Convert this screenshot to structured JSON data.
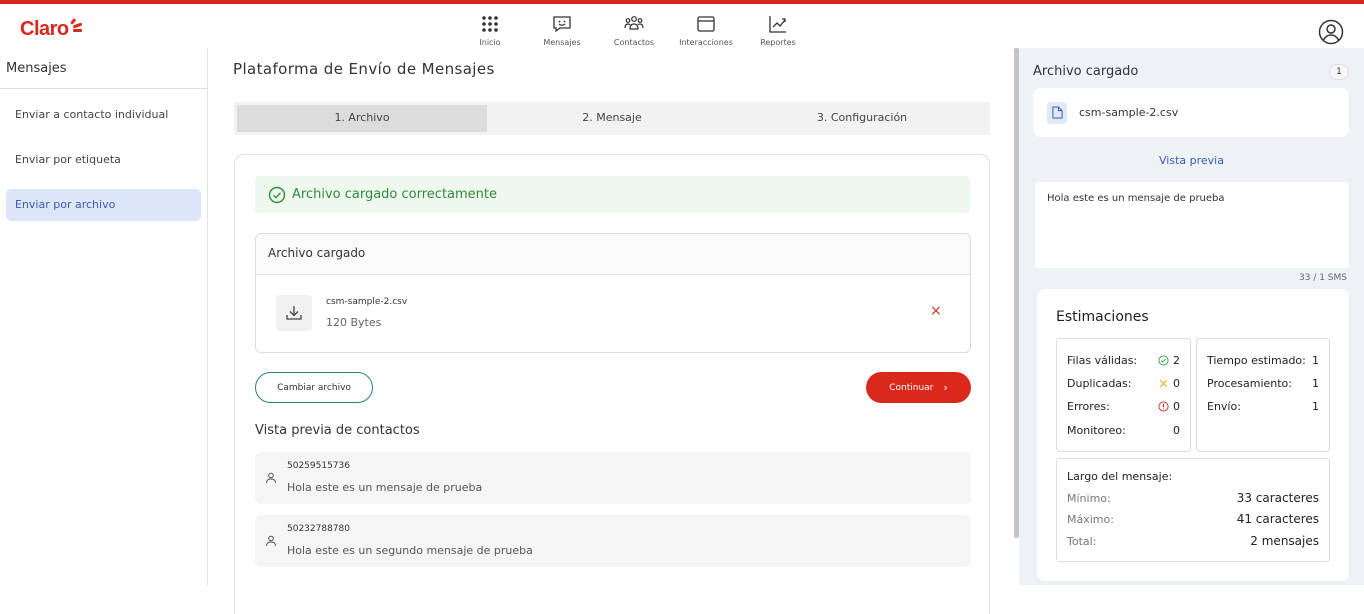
{
  "brand": {
    "logo_text": "Claro",
    "accent": "#da291c"
  },
  "nav": [
    {
      "label": "Inicio",
      "icon": "grid-icon"
    },
    {
      "label": "Mensajes",
      "icon": "message-icon"
    },
    {
      "label": "Contactos",
      "icon": "contacts-icon"
    },
    {
      "label": "Interacciones",
      "icon": "window-icon"
    },
    {
      "label": "Reportes",
      "icon": "chart-icon"
    }
  ],
  "sidebar": {
    "title": "Mensajes",
    "items": [
      {
        "label": "Enviar a contacto individual"
      },
      {
        "label": "Enviar por etiqueta"
      },
      {
        "label": "Enviar por archivo",
        "active": true
      }
    ]
  },
  "main": {
    "title": "Plataforma de Envío de Mensajes",
    "steps": [
      "1. Archivo",
      "2. Mensaje",
      "3. Configuración"
    ],
    "success_message": "Archivo cargado correctamente",
    "uploaded": {
      "header": "Archivo cargado",
      "file_name": "csm-sample-2.csv",
      "file_size": "120 Bytes",
      "remove": "×"
    },
    "change_button": "Cambiar archivo",
    "continue_button": "Continuar",
    "continue_chevron": "›",
    "contacts_title": "Vista previa de contactos",
    "contacts": [
      {
        "number": "50259515736",
        "message": "Hola este es un mensaje de prueba"
      },
      {
        "number": "50232788780",
        "message": "Hola este es un segundo mensaje de prueba"
      }
    ]
  },
  "right": {
    "title": "Archivo cargado",
    "badge": "1",
    "file_name": "csm-sample-2.csv",
    "preview_link": "Vista previa",
    "preview_text": "Hola este es un mensaje de prueba",
    "sms_count": "33 / 1 SMS",
    "estimations": {
      "title": "Estimaciones",
      "left": [
        {
          "label": "Filas válidas:",
          "value": "2",
          "icon": "check-circle-icon"
        },
        {
          "label": "Duplicadas:",
          "value": "0",
          "icon": "x-icon"
        },
        {
          "label": "Errores:",
          "value": "0",
          "icon": "alert-circle-icon"
        },
        {
          "label": "Monitoreo:",
          "value": "0",
          "icon": ""
        }
      ],
      "right": [
        {
          "label": "Tiempo estimado:",
          "value": "1"
        },
        {
          "label": "Procesamiento:",
          "value": "1"
        },
        {
          "label": "Envío:",
          "value": "1"
        }
      ],
      "length": {
        "title": "Largo del mensaje:",
        "rows": [
          {
            "label": "Mínimo:",
            "value": "33 caracteres"
          },
          {
            "label": "Máximo:",
            "value": "41 caracteres"
          },
          {
            "label": "Total:",
            "value": "2 mensajes"
          }
        ]
      }
    }
  }
}
